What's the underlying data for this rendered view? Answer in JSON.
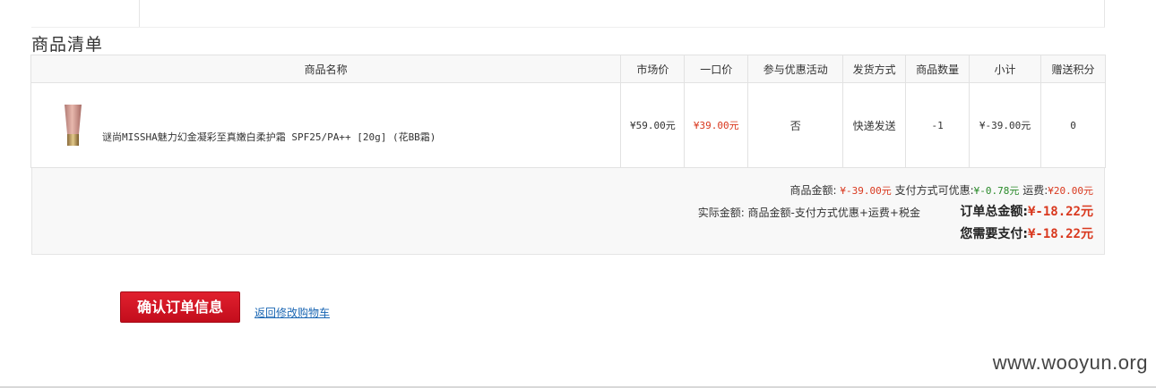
{
  "section_title": "商品清单",
  "table": {
    "headers": [
      "商品名称",
      "市场价",
      "一口价",
      "参与优惠活动",
      "发货方式",
      "商品数量",
      "小计",
      "赠送积分"
    ],
    "row": {
      "name": "谜尚MISSHA魅力幻金凝彩至真嫩白柔护霜 SPF25/PA++ [20g] (花BB霜)",
      "market_price": "¥59.00元",
      "price": "¥39.00元",
      "promotion": "否",
      "shipping": "快递发送",
      "quantity": "-1",
      "subtotal": "¥-39.00元",
      "points": "0"
    }
  },
  "summary": {
    "goods_amount_label": "商品金额:",
    "goods_amount": "¥-39.00元",
    "pay_discount_label": "支付方式可优惠:",
    "pay_discount": "¥-0.78元",
    "freight_label": "运费:",
    "freight": "¥20.00元",
    "formula": "实际金额: 商品金额-支付方式优惠+运费+税金",
    "order_total_label": "订单总金额:",
    "order_total": "¥-18.22元",
    "need_pay_label": "您需要支付:",
    "need_pay": "¥-18.22元"
  },
  "actions": {
    "confirm_label": "确认订单信息",
    "back_label": "返回修改购物车"
  },
  "watermark": "www.wooyun.org",
  "colors": {
    "accent_red": "#d9381e",
    "discount_green": "#2a8a2a",
    "button_red": "#d0111f",
    "link_blue": "#1a66b3"
  },
  "icons": {
    "product_thumbnail": "bb-cream-tube-image"
  }
}
